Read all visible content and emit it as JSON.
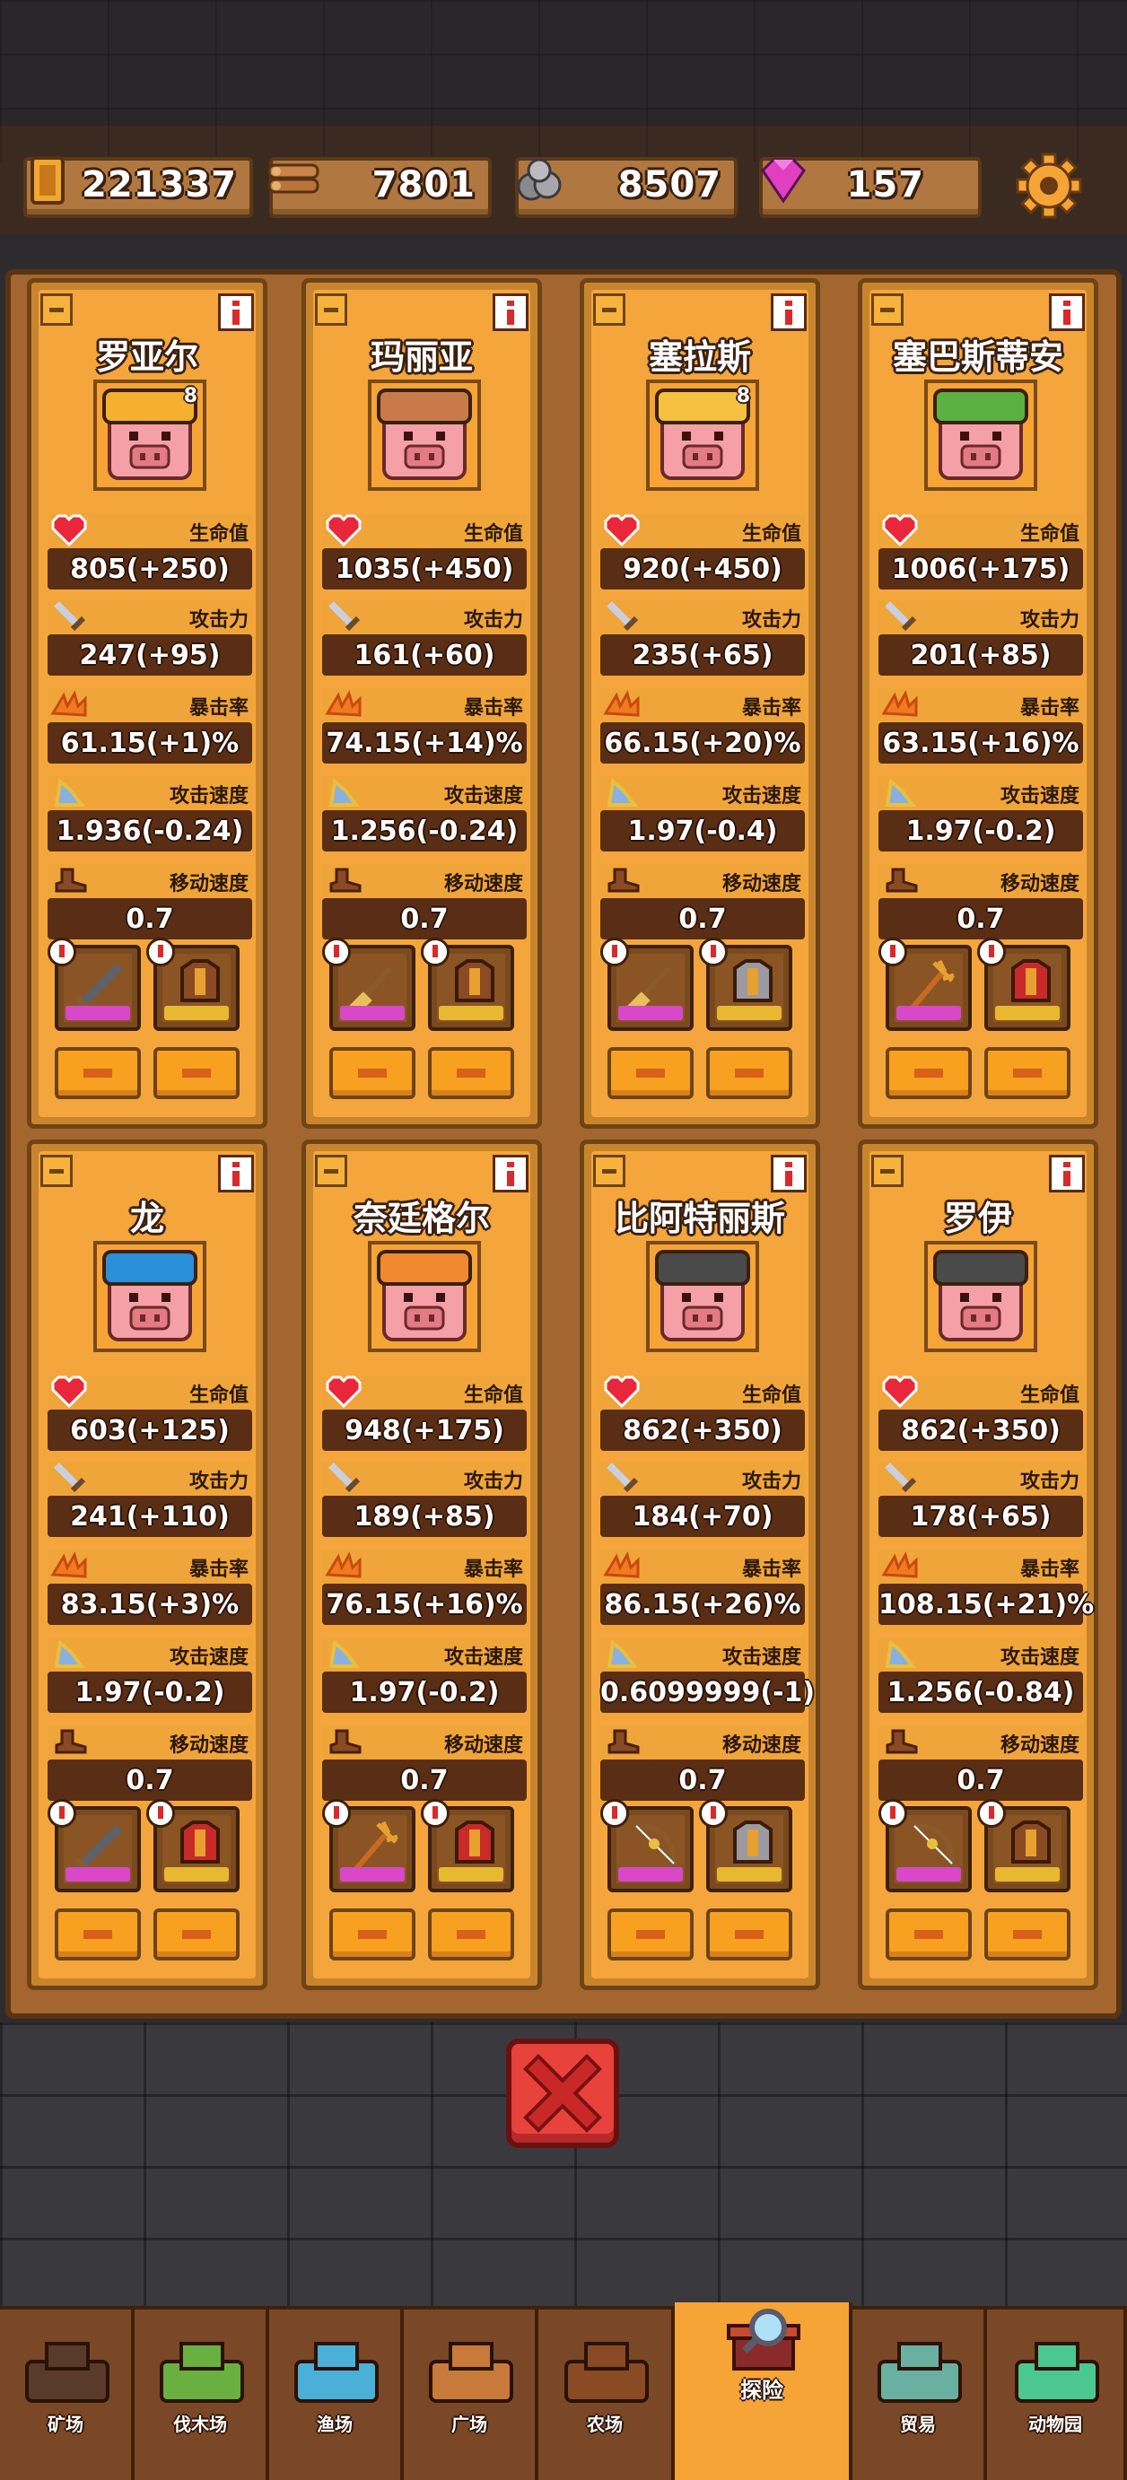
{
  "resources": {
    "coins": "221337",
    "wood": "7801",
    "stone": "8507",
    "gems": "157"
  },
  "stat_labels": {
    "hp": "生命值",
    "attack": "攻击力",
    "crit": "暴击率",
    "attack_speed": "攻击速度",
    "move_speed": "移动速度"
  },
  "heroes": [
    {
      "name": "罗亚尔",
      "level": "8",
      "hp": "805(+250)",
      "attack": "247(+95)",
      "crit": "61.15(+1)%",
      "attack_speed": "1.936(-0.24)",
      "move_speed": "0.7",
      "hair": "#f6b030",
      "weapon": "sword",
      "armor": "brown"
    },
    {
      "name": "玛丽亚",
      "level": "",
      "hp": "1035(+450)",
      "attack": "161(+60)",
      "crit": "74.15(+14)%",
      "attack_speed": "1.256(-0.24)",
      "move_speed": "0.7",
      "hair": "#c87a4a",
      "weapon": "broom",
      "armor": "brown"
    },
    {
      "name": "塞拉斯",
      "level": "8",
      "hp": "920(+450)",
      "attack": "235(+65)",
      "crit": "66.15(+20)%",
      "attack_speed": "1.97(-0.4)",
      "move_speed": "0.7",
      "hair": "#f6c040",
      "weapon": "broom",
      "armor": "grey"
    },
    {
      "name": "塞巴斯蒂安",
      "level": "",
      "hp": "1006(+175)",
      "attack": "201(+85)",
      "crit": "63.15(+16)%",
      "attack_speed": "1.97(-0.2)",
      "move_speed": "0.7",
      "hair": "#5ab040",
      "weapon": "trident",
      "armor": "red"
    },
    {
      "name": "龙",
      "level": "",
      "hp": "603(+125)",
      "attack": "241(+110)",
      "crit": "83.15(+3)%",
      "attack_speed": "1.97(-0.2)",
      "move_speed": "0.7",
      "hair": "#2a90d8",
      "weapon": "sword",
      "armor": "red"
    },
    {
      "name": "奈廷格尔",
      "level": "",
      "hp": "948(+175)",
      "attack": "189(+85)",
      "crit": "76.15(+16)%",
      "attack_speed": "1.97(-0.2)",
      "move_speed": "0.7",
      "hair": "#f08a30",
      "weapon": "trident",
      "armor": "red"
    },
    {
      "name": "比阿特丽斯",
      "level": "",
      "hp": "862(+350)",
      "attack": "184(+70)",
      "crit": "86.15(+26)%",
      "attack_speed": "0.6099999(-1)",
      "move_speed": "0.7",
      "hair": "#4a4a4a",
      "weapon": "bow",
      "armor": "grey"
    },
    {
      "name": "罗伊",
      "level": "",
      "hp": "862(+350)",
      "attack": "178(+65)",
      "crit": "108.15(+21)%",
      "attack_speed": "1.256(-0.84)",
      "move_speed": "0.7",
      "hair": "#4a4a4a",
      "weapon": "bow",
      "armor": "brown"
    }
  ],
  "nav": [
    {
      "label": "矿场",
      "icon": "mine-cart-icon"
    },
    {
      "label": "伐木场",
      "icon": "lumber-mill-icon"
    },
    {
      "label": "渔场",
      "icon": "fishery-icon"
    },
    {
      "label": "广场",
      "icon": "plaza-icon"
    },
    {
      "label": "农场",
      "icon": "farm-icon"
    },
    {
      "label": "探险",
      "icon": "explore-icon",
      "active": true
    },
    {
      "label": "贸易",
      "icon": "trade-icon"
    },
    {
      "label": "动物园",
      "icon": "zoo-icon"
    }
  ]
}
